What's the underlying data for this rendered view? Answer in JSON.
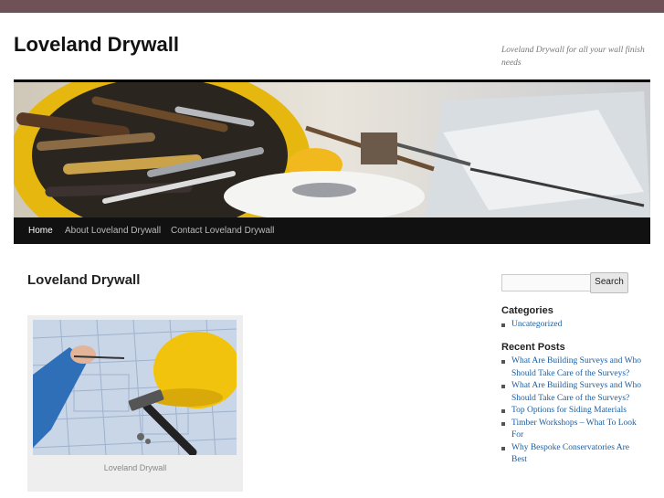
{
  "site": {
    "title": "Loveland Drywall",
    "tagline": "Loveland Drywall for all your wall finish needs"
  },
  "nav": {
    "items": [
      {
        "label": "Home"
      },
      {
        "label": "About Loveland Drywall"
      },
      {
        "label": "Contact Loveland Drywall"
      }
    ]
  },
  "main": {
    "post_title": "Loveland Drywall",
    "image_caption": "Loveland Drywall"
  },
  "sidebar": {
    "search_button": "Search",
    "search_value": "",
    "categories_title": "Categories",
    "categories": [
      "Uncategorized"
    ],
    "recent_title": "Recent Posts",
    "recent_posts": [
      "What Are Building Surveys and Who Should Take Care of the Surveys?",
      "What Are Building Surveys and Who Should Take Care of the Surveys?",
      "Top Options for Siding Materials",
      "Timber Workshops – What To Look For",
      "Why Bespoke Conservatories Are Best"
    ]
  },
  "colors": {
    "top_band": "#6e5257",
    "nav_bg": "#111111",
    "link": "#1b5ea0"
  }
}
